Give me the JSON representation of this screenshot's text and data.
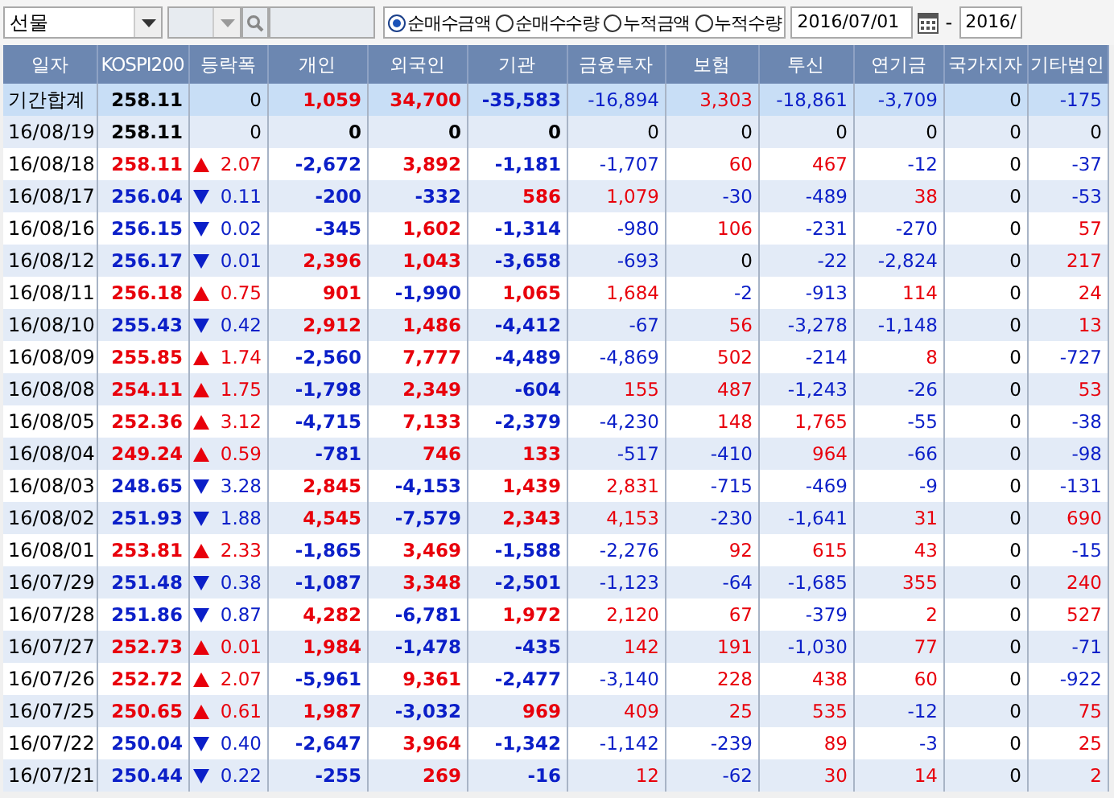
{
  "toolbar": {
    "market_select": {
      "value": "선물"
    },
    "modes": [
      {
        "label": "순매수금액",
        "selected": true
      },
      {
        "label": "순매수수량",
        "selected": false
      },
      {
        "label": "누적금액",
        "selected": false
      },
      {
        "label": "누적수량",
        "selected": false
      }
    ],
    "start_date": "2016/07/01",
    "separator": "-",
    "end_date": "2016/"
  },
  "table": {
    "columns": [
      "일자",
      "KOSPI200",
      "등락폭",
      "개인",
      "외국인",
      "기관",
      "금융투자",
      "보험",
      "투신",
      "연기금",
      "국가지자",
      "기타법인"
    ],
    "rows": [
      {
        "date": "기간합계",
        "index": {
          "text": "258.11",
          "color": "#000000"
        },
        "change": {
          "text": "0",
          "kind": "none",
          "color": "#000000"
        },
        "values": [
          {
            "text": "1,059",
            "color": "#e8000b"
          },
          {
            "text": "34,700",
            "color": "#e8000b"
          },
          {
            "text": "-35,583",
            "color": "#0b1fc8"
          },
          {
            "text": "-16,894",
            "color": "#0b1fc8"
          },
          {
            "text": "3,303",
            "color": "#e8000b"
          },
          {
            "text": "-18,861",
            "color": "#0b1fc8"
          },
          {
            "text": "-3,709",
            "color": "#0b1fc8"
          },
          {
            "text": "0",
            "color": "#000000"
          },
          {
            "text": "-175",
            "color": "#0b1fc8"
          }
        ]
      },
      {
        "date": "16/08/19",
        "index": {
          "text": "258.11",
          "color": "#000000"
        },
        "change": {
          "text": "0",
          "kind": "none",
          "color": "#000000"
        },
        "values": [
          {
            "text": "0",
            "color": "#000000"
          },
          {
            "text": "0",
            "color": "#000000"
          },
          {
            "text": "0",
            "color": "#000000"
          },
          {
            "text": "0",
            "color": "#000000"
          },
          {
            "text": "0",
            "color": "#000000"
          },
          {
            "text": "0",
            "color": "#000000"
          },
          {
            "text": "0",
            "color": "#000000"
          },
          {
            "text": "0",
            "color": "#000000"
          },
          {
            "text": "0",
            "color": "#000000"
          }
        ]
      },
      {
        "date": "16/08/18",
        "index": {
          "text": "258.11",
          "color": "#e8000b"
        },
        "change": {
          "text": "2.07",
          "kind": "up",
          "color": "#e8000b"
        },
        "values": [
          {
            "text": "-2,672",
            "color": "#0b1fc8"
          },
          {
            "text": "3,892",
            "color": "#e8000b"
          },
          {
            "text": "-1,181",
            "color": "#0b1fc8"
          },
          {
            "text": "-1,707",
            "color": "#0b1fc8"
          },
          {
            "text": "60",
            "color": "#e8000b"
          },
          {
            "text": "467",
            "color": "#e8000b"
          },
          {
            "text": "-12",
            "color": "#0b1fc8"
          },
          {
            "text": "0",
            "color": "#000000"
          },
          {
            "text": "-37",
            "color": "#0b1fc8"
          }
        ]
      },
      {
        "date": "16/08/17",
        "index": {
          "text": "256.04",
          "color": "#0b1fc8"
        },
        "change": {
          "text": "0.11",
          "kind": "down",
          "color": "#0b1fc8"
        },
        "values": [
          {
            "text": "-200",
            "color": "#0b1fc8"
          },
          {
            "text": "-332",
            "color": "#0b1fc8"
          },
          {
            "text": "586",
            "color": "#e8000b"
          },
          {
            "text": "1,079",
            "color": "#e8000b"
          },
          {
            "text": "-30",
            "color": "#0b1fc8"
          },
          {
            "text": "-489",
            "color": "#0b1fc8"
          },
          {
            "text": "38",
            "color": "#e8000b"
          },
          {
            "text": "0",
            "color": "#000000"
          },
          {
            "text": "-53",
            "color": "#0b1fc8"
          }
        ]
      },
      {
        "date": "16/08/16",
        "index": {
          "text": "256.15",
          "color": "#0b1fc8"
        },
        "change": {
          "text": "0.02",
          "kind": "down",
          "color": "#0b1fc8"
        },
        "values": [
          {
            "text": "-345",
            "color": "#0b1fc8"
          },
          {
            "text": "1,602",
            "color": "#e8000b"
          },
          {
            "text": "-1,314",
            "color": "#0b1fc8"
          },
          {
            "text": "-980",
            "color": "#0b1fc8"
          },
          {
            "text": "106",
            "color": "#e8000b"
          },
          {
            "text": "-231",
            "color": "#0b1fc8"
          },
          {
            "text": "-270",
            "color": "#0b1fc8"
          },
          {
            "text": "0",
            "color": "#000000"
          },
          {
            "text": "57",
            "color": "#e8000b"
          }
        ]
      },
      {
        "date": "16/08/12",
        "index": {
          "text": "256.17",
          "color": "#0b1fc8"
        },
        "change": {
          "text": "0.01",
          "kind": "down",
          "color": "#0b1fc8"
        },
        "values": [
          {
            "text": "2,396",
            "color": "#e8000b"
          },
          {
            "text": "1,043",
            "color": "#e8000b"
          },
          {
            "text": "-3,658",
            "color": "#0b1fc8"
          },
          {
            "text": "-693",
            "color": "#0b1fc8"
          },
          {
            "text": "0",
            "color": "#000000"
          },
          {
            "text": "-22",
            "color": "#0b1fc8"
          },
          {
            "text": "-2,824",
            "color": "#0b1fc8"
          },
          {
            "text": "0",
            "color": "#000000"
          },
          {
            "text": "217",
            "color": "#e8000b"
          }
        ]
      },
      {
        "date": "16/08/11",
        "index": {
          "text": "256.18",
          "color": "#e8000b"
        },
        "change": {
          "text": "0.75",
          "kind": "up",
          "color": "#e8000b"
        },
        "values": [
          {
            "text": "901",
            "color": "#e8000b"
          },
          {
            "text": "-1,990",
            "color": "#0b1fc8"
          },
          {
            "text": "1,065",
            "color": "#e8000b"
          },
          {
            "text": "1,684",
            "color": "#e8000b"
          },
          {
            "text": "-2",
            "color": "#0b1fc8"
          },
          {
            "text": "-913",
            "color": "#0b1fc8"
          },
          {
            "text": "114",
            "color": "#e8000b"
          },
          {
            "text": "0",
            "color": "#000000"
          },
          {
            "text": "24",
            "color": "#e8000b"
          }
        ]
      },
      {
        "date": "16/08/10",
        "index": {
          "text": "255.43",
          "color": "#0b1fc8"
        },
        "change": {
          "text": "0.42",
          "kind": "down",
          "color": "#0b1fc8"
        },
        "values": [
          {
            "text": "2,912",
            "color": "#e8000b"
          },
          {
            "text": "1,486",
            "color": "#e8000b"
          },
          {
            "text": "-4,412",
            "color": "#0b1fc8"
          },
          {
            "text": "-67",
            "color": "#0b1fc8"
          },
          {
            "text": "56",
            "color": "#e8000b"
          },
          {
            "text": "-3,278",
            "color": "#0b1fc8"
          },
          {
            "text": "-1,148",
            "color": "#0b1fc8"
          },
          {
            "text": "0",
            "color": "#000000"
          },
          {
            "text": "13",
            "color": "#e8000b"
          }
        ]
      },
      {
        "date": "16/08/09",
        "index": {
          "text": "255.85",
          "color": "#e8000b"
        },
        "change": {
          "text": "1.74",
          "kind": "up",
          "color": "#e8000b"
        },
        "values": [
          {
            "text": "-2,560",
            "color": "#0b1fc8"
          },
          {
            "text": "7,777",
            "color": "#e8000b"
          },
          {
            "text": "-4,489",
            "color": "#0b1fc8"
          },
          {
            "text": "-4,869",
            "color": "#0b1fc8"
          },
          {
            "text": "502",
            "color": "#e8000b"
          },
          {
            "text": "-214",
            "color": "#0b1fc8"
          },
          {
            "text": "8",
            "color": "#e8000b"
          },
          {
            "text": "0",
            "color": "#000000"
          },
          {
            "text": "-727",
            "color": "#0b1fc8"
          }
        ]
      },
      {
        "date": "16/08/08",
        "index": {
          "text": "254.11",
          "color": "#e8000b"
        },
        "change": {
          "text": "1.75",
          "kind": "up",
          "color": "#e8000b"
        },
        "values": [
          {
            "text": "-1,798",
            "color": "#0b1fc8"
          },
          {
            "text": "2,349",
            "color": "#e8000b"
          },
          {
            "text": "-604",
            "color": "#0b1fc8"
          },
          {
            "text": "155",
            "color": "#e8000b"
          },
          {
            "text": "487",
            "color": "#e8000b"
          },
          {
            "text": "-1,243",
            "color": "#0b1fc8"
          },
          {
            "text": "-26",
            "color": "#0b1fc8"
          },
          {
            "text": "0",
            "color": "#000000"
          },
          {
            "text": "53",
            "color": "#e8000b"
          }
        ]
      },
      {
        "date": "16/08/05",
        "index": {
          "text": "252.36",
          "color": "#e8000b"
        },
        "change": {
          "text": "3.12",
          "kind": "up",
          "color": "#e8000b"
        },
        "values": [
          {
            "text": "-4,715",
            "color": "#0b1fc8"
          },
          {
            "text": "7,133",
            "color": "#e8000b"
          },
          {
            "text": "-2,379",
            "color": "#0b1fc8"
          },
          {
            "text": "-4,230",
            "color": "#0b1fc8"
          },
          {
            "text": "148",
            "color": "#e8000b"
          },
          {
            "text": "1,765",
            "color": "#e8000b"
          },
          {
            "text": "-55",
            "color": "#0b1fc8"
          },
          {
            "text": "0",
            "color": "#000000"
          },
          {
            "text": "-38",
            "color": "#0b1fc8"
          }
        ]
      },
      {
        "date": "16/08/04",
        "index": {
          "text": "249.24",
          "color": "#e8000b"
        },
        "change": {
          "text": "0.59",
          "kind": "up",
          "color": "#e8000b"
        },
        "values": [
          {
            "text": "-781",
            "color": "#0b1fc8"
          },
          {
            "text": "746",
            "color": "#e8000b"
          },
          {
            "text": "133",
            "color": "#e8000b"
          },
          {
            "text": "-517",
            "color": "#0b1fc8"
          },
          {
            "text": "-410",
            "color": "#0b1fc8"
          },
          {
            "text": "964",
            "color": "#e8000b"
          },
          {
            "text": "-66",
            "color": "#0b1fc8"
          },
          {
            "text": "0",
            "color": "#000000"
          },
          {
            "text": "-98",
            "color": "#0b1fc8"
          }
        ]
      },
      {
        "date": "16/08/03",
        "index": {
          "text": "248.65",
          "color": "#0b1fc8"
        },
        "change": {
          "text": "3.28",
          "kind": "down",
          "color": "#0b1fc8"
        },
        "values": [
          {
            "text": "2,845",
            "color": "#e8000b"
          },
          {
            "text": "-4,153",
            "color": "#0b1fc8"
          },
          {
            "text": "1,439",
            "color": "#e8000b"
          },
          {
            "text": "2,831",
            "color": "#e8000b"
          },
          {
            "text": "-715",
            "color": "#0b1fc8"
          },
          {
            "text": "-469",
            "color": "#0b1fc8"
          },
          {
            "text": "-9",
            "color": "#0b1fc8"
          },
          {
            "text": "0",
            "color": "#000000"
          },
          {
            "text": "-131",
            "color": "#0b1fc8"
          }
        ]
      },
      {
        "date": "16/08/02",
        "index": {
          "text": "251.93",
          "color": "#0b1fc8"
        },
        "change": {
          "text": "1.88",
          "kind": "down",
          "color": "#0b1fc8"
        },
        "values": [
          {
            "text": "4,545",
            "color": "#e8000b"
          },
          {
            "text": "-7,579",
            "color": "#0b1fc8"
          },
          {
            "text": "2,343",
            "color": "#e8000b"
          },
          {
            "text": "4,153",
            "color": "#e8000b"
          },
          {
            "text": "-230",
            "color": "#0b1fc8"
          },
          {
            "text": "-1,641",
            "color": "#0b1fc8"
          },
          {
            "text": "31",
            "color": "#e8000b"
          },
          {
            "text": "0",
            "color": "#000000"
          },
          {
            "text": "690",
            "color": "#e8000b"
          }
        ]
      },
      {
        "date": "16/08/01",
        "index": {
          "text": "253.81",
          "color": "#e8000b"
        },
        "change": {
          "text": "2.33",
          "kind": "up",
          "color": "#e8000b"
        },
        "values": [
          {
            "text": "-1,865",
            "color": "#0b1fc8"
          },
          {
            "text": "3,469",
            "color": "#e8000b"
          },
          {
            "text": "-1,588",
            "color": "#0b1fc8"
          },
          {
            "text": "-2,276",
            "color": "#0b1fc8"
          },
          {
            "text": "92",
            "color": "#e8000b"
          },
          {
            "text": "615",
            "color": "#e8000b"
          },
          {
            "text": "43",
            "color": "#e8000b"
          },
          {
            "text": "0",
            "color": "#000000"
          },
          {
            "text": "-15",
            "color": "#0b1fc8"
          }
        ]
      },
      {
        "date": "16/07/29",
        "index": {
          "text": "251.48",
          "color": "#0b1fc8"
        },
        "change": {
          "text": "0.38",
          "kind": "down",
          "color": "#0b1fc8"
        },
        "values": [
          {
            "text": "-1,087",
            "color": "#0b1fc8"
          },
          {
            "text": "3,348",
            "color": "#e8000b"
          },
          {
            "text": "-2,501",
            "color": "#0b1fc8"
          },
          {
            "text": "-1,123",
            "color": "#0b1fc8"
          },
          {
            "text": "-64",
            "color": "#0b1fc8"
          },
          {
            "text": "-1,685",
            "color": "#0b1fc8"
          },
          {
            "text": "355",
            "color": "#e8000b"
          },
          {
            "text": "0",
            "color": "#000000"
          },
          {
            "text": "240",
            "color": "#e8000b"
          }
        ]
      },
      {
        "date": "16/07/28",
        "index": {
          "text": "251.86",
          "color": "#0b1fc8"
        },
        "change": {
          "text": "0.87",
          "kind": "down",
          "color": "#0b1fc8"
        },
        "values": [
          {
            "text": "4,282",
            "color": "#e8000b"
          },
          {
            "text": "-6,781",
            "color": "#0b1fc8"
          },
          {
            "text": "1,972",
            "color": "#e8000b"
          },
          {
            "text": "2,120",
            "color": "#e8000b"
          },
          {
            "text": "67",
            "color": "#e8000b"
          },
          {
            "text": "-379",
            "color": "#0b1fc8"
          },
          {
            "text": "2",
            "color": "#e8000b"
          },
          {
            "text": "0",
            "color": "#000000"
          },
          {
            "text": "527",
            "color": "#e8000b"
          }
        ]
      },
      {
        "date": "16/07/27",
        "index": {
          "text": "252.73",
          "color": "#e8000b"
        },
        "change": {
          "text": "0.01",
          "kind": "up",
          "color": "#e8000b"
        },
        "values": [
          {
            "text": "1,984",
            "color": "#e8000b"
          },
          {
            "text": "-1,478",
            "color": "#0b1fc8"
          },
          {
            "text": "-435",
            "color": "#0b1fc8"
          },
          {
            "text": "142",
            "color": "#e8000b"
          },
          {
            "text": "191",
            "color": "#e8000b"
          },
          {
            "text": "-1,030",
            "color": "#0b1fc8"
          },
          {
            "text": "77",
            "color": "#e8000b"
          },
          {
            "text": "0",
            "color": "#000000"
          },
          {
            "text": "-71",
            "color": "#0b1fc8"
          }
        ]
      },
      {
        "date": "16/07/26",
        "index": {
          "text": "252.72",
          "color": "#e8000b"
        },
        "change": {
          "text": "2.07",
          "kind": "up",
          "color": "#e8000b"
        },
        "values": [
          {
            "text": "-5,961",
            "color": "#0b1fc8"
          },
          {
            "text": "9,361",
            "color": "#e8000b"
          },
          {
            "text": "-2,477",
            "color": "#0b1fc8"
          },
          {
            "text": "-3,140",
            "color": "#0b1fc8"
          },
          {
            "text": "228",
            "color": "#e8000b"
          },
          {
            "text": "438",
            "color": "#e8000b"
          },
          {
            "text": "60",
            "color": "#e8000b"
          },
          {
            "text": "0",
            "color": "#000000"
          },
          {
            "text": "-922",
            "color": "#0b1fc8"
          }
        ]
      },
      {
        "date": "16/07/25",
        "index": {
          "text": "250.65",
          "color": "#e8000b"
        },
        "change": {
          "text": "0.61",
          "kind": "up",
          "color": "#e8000b"
        },
        "values": [
          {
            "text": "1,987",
            "color": "#e8000b"
          },
          {
            "text": "-3,032",
            "color": "#0b1fc8"
          },
          {
            "text": "969",
            "color": "#e8000b"
          },
          {
            "text": "409",
            "color": "#e8000b"
          },
          {
            "text": "25",
            "color": "#e8000b"
          },
          {
            "text": "535",
            "color": "#e8000b"
          },
          {
            "text": "-12",
            "color": "#0b1fc8"
          },
          {
            "text": "0",
            "color": "#000000"
          },
          {
            "text": "75",
            "color": "#e8000b"
          }
        ]
      },
      {
        "date": "16/07/22",
        "index": {
          "text": "250.04",
          "color": "#0b1fc8"
        },
        "change": {
          "text": "0.40",
          "kind": "down",
          "color": "#0b1fc8"
        },
        "values": [
          {
            "text": "-2,647",
            "color": "#0b1fc8"
          },
          {
            "text": "3,964",
            "color": "#e8000b"
          },
          {
            "text": "-1,342",
            "color": "#0b1fc8"
          },
          {
            "text": "-1,142",
            "color": "#0b1fc8"
          },
          {
            "text": "-239",
            "color": "#0b1fc8"
          },
          {
            "text": "89",
            "color": "#e8000b"
          },
          {
            "text": "-3",
            "color": "#0b1fc8"
          },
          {
            "text": "0",
            "color": "#000000"
          },
          {
            "text": "25",
            "color": "#e8000b"
          }
        ]
      },
      {
        "date": "16/07/21",
        "index": {
          "text": "250.44",
          "color": "#0b1fc8"
        },
        "change": {
          "text": "0.22",
          "kind": "down",
          "color": "#0b1fc8"
        },
        "values": [
          {
            "text": "-255",
            "color": "#0b1fc8"
          },
          {
            "text": "269",
            "color": "#e8000b"
          },
          {
            "text": "-16",
            "color": "#0b1fc8"
          },
          {
            "text": "12",
            "color": "#e8000b"
          },
          {
            "text": "-62",
            "color": "#0b1fc8"
          },
          {
            "text": "30",
            "color": "#e8000b"
          },
          {
            "text": "14",
            "color": "#e8000b"
          },
          {
            "text": "0",
            "color": "#000000"
          },
          {
            "text": "2",
            "color": "#e8000b"
          }
        ]
      }
    ]
  }
}
